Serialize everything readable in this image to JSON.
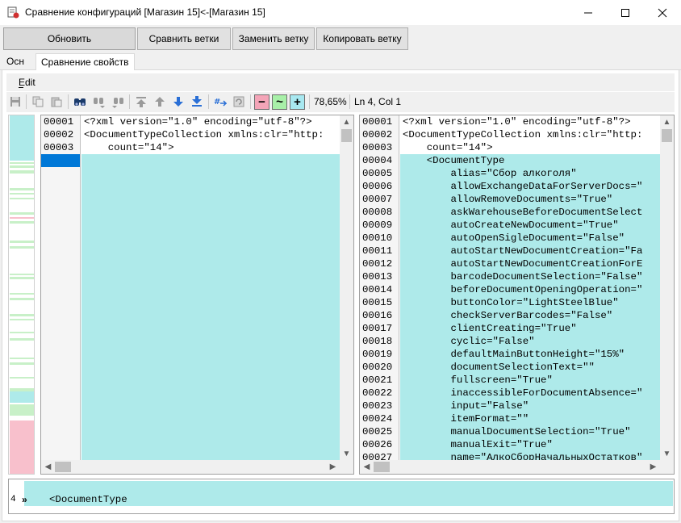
{
  "window": {
    "title": "Сравнение конфигураций [Магазин 15]<-[Магазин 15]"
  },
  "buttons": {
    "refresh": "Обновить",
    "compare_branches": "Сравнить ветки",
    "replace_branch": "Заменить ветку",
    "copy_branch": "Копировать ветку"
  },
  "tabs": {
    "osn": "Осн",
    "compare_props": "Сравнение свойств"
  },
  "menu": {
    "edit": "Edit"
  },
  "toolbar": {
    "icons": [
      "save-icon",
      "copy-icon",
      "paste-icon",
      "find-icon",
      "find-next-icon",
      "find-prev-icon",
      "first-diff-icon",
      "prev-diff-icon",
      "next-diff-icon",
      "last-diff-icon",
      "goto-line-icon",
      "refresh-icon"
    ],
    "diff_minus": "−",
    "diff_tilde": "~",
    "diff_plus": "+",
    "zoom": "78,65%",
    "position": "Ln 4, Col 1",
    "colors": {
      "minus_bg": "#f4a5b8",
      "tilde_bg": "#a8f0a8",
      "plus_bg": "#a8e8f0"
    }
  },
  "left_pane": {
    "lines": [
      {
        "num": "00001",
        "text": "<?xml version=\"1.0\" encoding=\"utf-8\"?>"
      },
      {
        "num": "00002",
        "text": "<DocumentTypeCollection xmlns:clr=\"http:"
      },
      {
        "num": "00003",
        "text": "    count=\"14\">"
      }
    ]
  },
  "right_pane": {
    "lines": [
      {
        "num": "00001",
        "text": "<?xml version=\"1.0\" encoding=\"utf-8\"?>"
      },
      {
        "num": "00002",
        "text": "<DocumentTypeCollection xmlns:clr=\"http:"
      },
      {
        "num": "00003",
        "text": "    count=\"14\">"
      },
      {
        "num": "00004",
        "text": "    <DocumentType"
      },
      {
        "num": "00005",
        "text": "        alias=\"Сбор алкоголя\""
      },
      {
        "num": "00006",
        "text": "        allowExchangeDataForServerDocs=\""
      },
      {
        "num": "00007",
        "text": "        allowRemoveDocuments=\"True\""
      },
      {
        "num": "00008",
        "text": "        askWarehouseBeforeDocumentSelect"
      },
      {
        "num": "00009",
        "text": "        autoCreateNewDocument=\"True\""
      },
      {
        "num": "00010",
        "text": "        autoOpenSigleDocument=\"False\""
      },
      {
        "num": "00011",
        "text": "        autoStartNewDocumentCreation=\"Fa"
      },
      {
        "num": "00012",
        "text": "        autoStartNewDocumentCreationForE"
      },
      {
        "num": "00013",
        "text": "        barcodeDocumentSelection=\"False\""
      },
      {
        "num": "00014",
        "text": "        beforeDocumentOpeningOperation=\""
      },
      {
        "num": "00015",
        "text": "        buttonColor=\"LightSteelBlue\""
      },
      {
        "num": "00016",
        "text": "        checkServerBarcodes=\"False\""
      },
      {
        "num": "00017",
        "text": "        clientCreating=\"True\""
      },
      {
        "num": "00018",
        "text": "        cyclic=\"False\""
      },
      {
        "num": "00019",
        "text": "        defaultMainButtonHeight=\"15%\""
      },
      {
        "num": "00020",
        "text": "        documentSelectionText=\"\""
      },
      {
        "num": "00021",
        "text": "        fullscreen=\"True\""
      },
      {
        "num": "00022",
        "text": "        inaccessibleForDocumentAbsence=\""
      },
      {
        "num": "00023",
        "text": "        input=\"False\""
      },
      {
        "num": "00024",
        "text": "        itemFormat=\"\""
      },
      {
        "num": "00025",
        "text": "        manualDocumentSelection=\"True\""
      },
      {
        "num": "00026",
        "text": "        manualExit=\"True\""
      },
      {
        "num": "00027",
        "text": "        name=\"АлкоСборНачальныхОстатков\""
      }
    ]
  },
  "detail": {
    "line_number": "4",
    "marker": "»",
    "text": "<DocumentType"
  },
  "colors": {
    "added_highlight": "#aeeaea",
    "cursor_line": "#0078d7",
    "overview_removed": "#f8c0cc",
    "overview_changed": "#c8f0c8"
  }
}
